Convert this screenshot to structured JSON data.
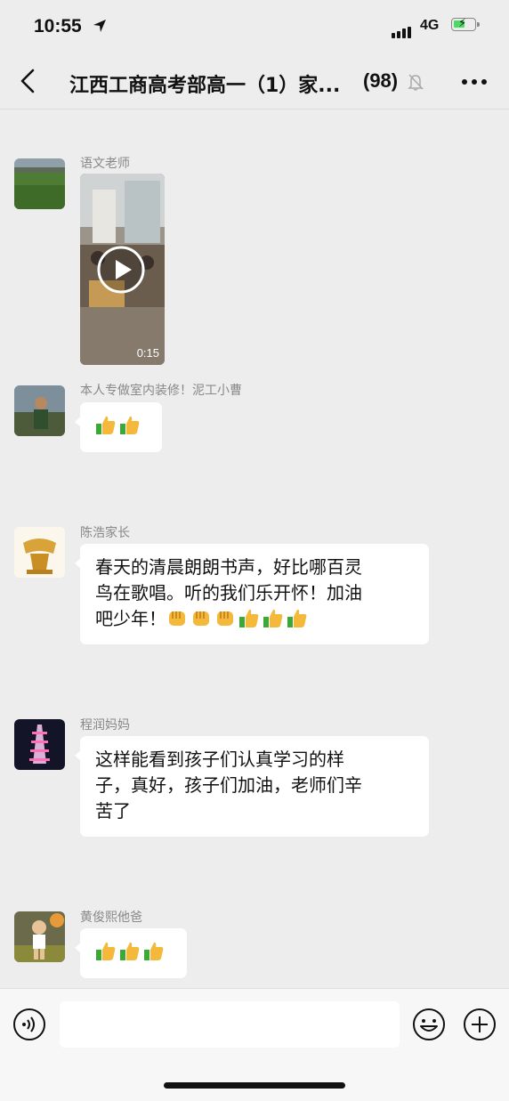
{
  "status_bar": {
    "time": "10:55",
    "network": "4G",
    "battery_level": 0.55
  },
  "header": {
    "title": "江西工商高考部高一（1）家...",
    "member_count": "(98)"
  },
  "messages": [
    {
      "sender": "语文老师",
      "type": "video",
      "duration": "0:15"
    },
    {
      "sender": "本人专做室内装修！泥工小曹",
      "type": "text",
      "text": "",
      "emojis": [
        "thumbs-up",
        "thumbs-up"
      ]
    },
    {
      "sender": "陈浩家长",
      "type": "text",
      "lines": [
        "春天的清晨朗朗书声，好比哪百灵",
        "鸟在歌唱。听的我们乐开怀！加油",
        "吧少年！"
      ],
      "emojis": [
        "fist",
        "fist",
        "fist",
        "thumbs-up",
        "thumbs-up",
        "thumbs-up"
      ]
    },
    {
      "sender": "程润妈妈",
      "type": "text",
      "lines": [
        "这样能看到孩子们认真学习的样",
        "子，真好，孩子们加油，老师们辛",
        "苦了"
      ]
    },
    {
      "sender": "黄俊熙他爸",
      "type": "text",
      "emojis": [
        "thumbs-up",
        "thumbs-up",
        "thumbs-up"
      ]
    }
  ],
  "input_bar": {
    "value": "",
    "voice_icon": "voice-icon",
    "emoji_icon": "emoji-icon",
    "plus_icon": "plus-icon"
  },
  "colors": {
    "background": "#ededed",
    "bubble": "#ffffff",
    "sender": "#888888"
  }
}
